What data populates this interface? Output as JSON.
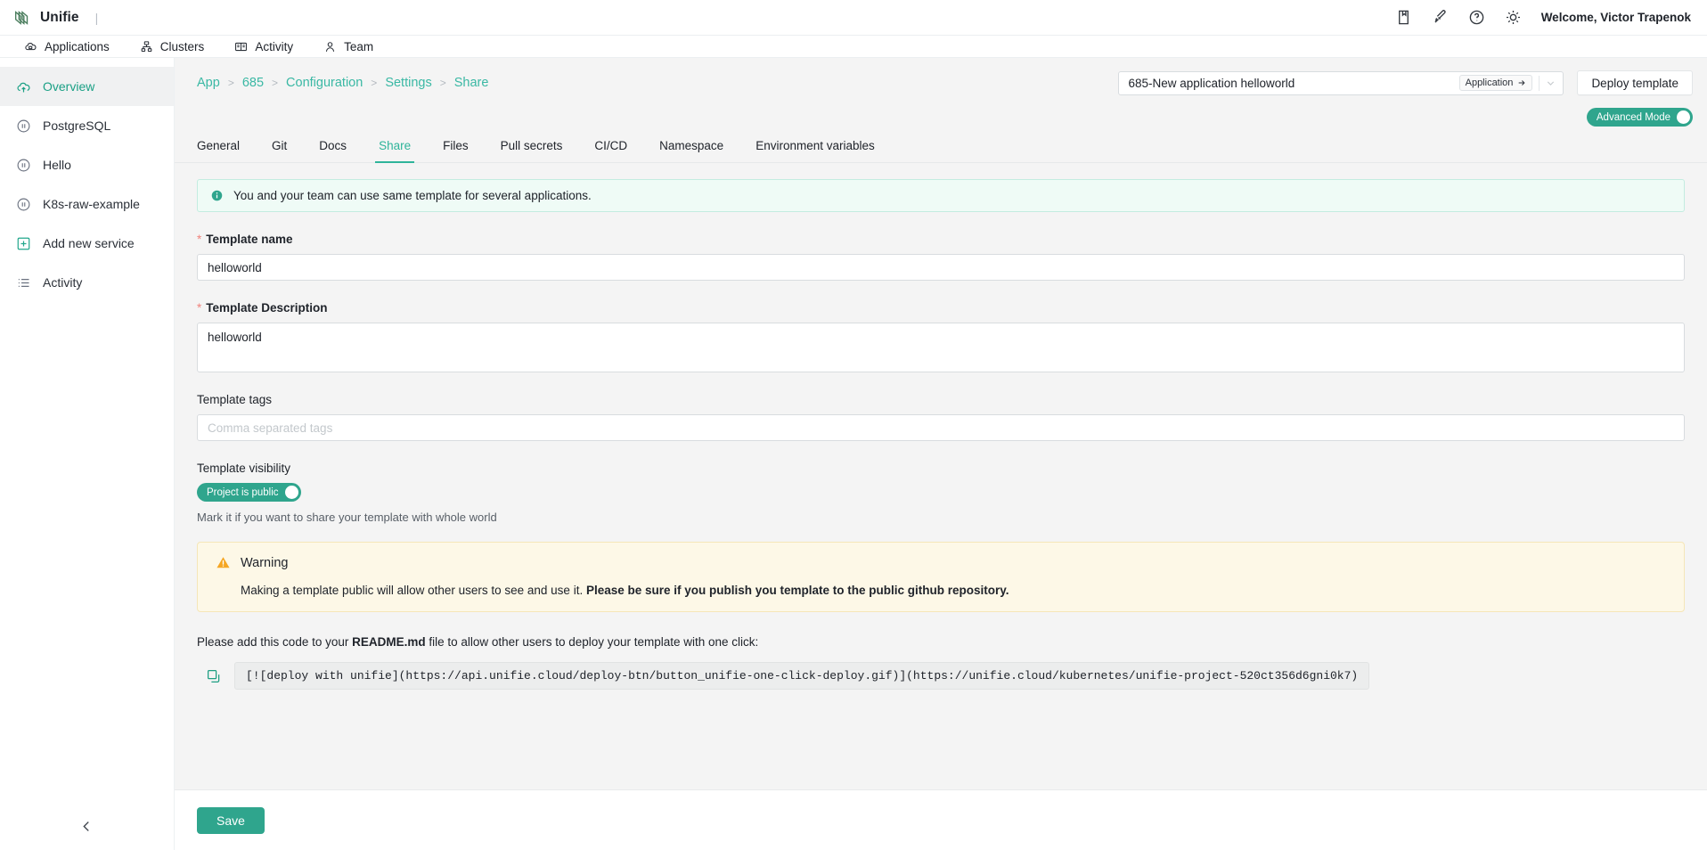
{
  "topbar": {
    "brand": "Unifie",
    "divider": "|",
    "welcome": "Welcome, Victor Trapenok",
    "icons": [
      "book-icon",
      "rocket-icon",
      "help-circle-icon",
      "sun-icon"
    ]
  },
  "nav": {
    "items": [
      {
        "label": "Applications",
        "icon": "cloud-apps-icon"
      },
      {
        "label": "Clusters",
        "icon": "cluster-icon"
      },
      {
        "label": "Activity",
        "icon": "book-open-icon"
      },
      {
        "label": "Team",
        "icon": "user-icon"
      }
    ]
  },
  "sidebar": {
    "items": [
      {
        "label": "Overview",
        "icon": "cloud-up-icon",
        "active": true
      },
      {
        "label": "PostgreSQL",
        "icon": "pause-circle-icon",
        "active": false
      },
      {
        "label": "Hello",
        "icon": "pause-circle-icon",
        "active": false
      },
      {
        "label": "K8s-raw-example",
        "icon": "pause-circle-icon",
        "active": false
      },
      {
        "label": "Add new service",
        "icon": "plus-square-icon",
        "active": false
      },
      {
        "label": "Activity",
        "icon": "list-icon",
        "active": false
      }
    ],
    "collapse_icon": "chevron-left-icon"
  },
  "breadcrumb": {
    "items": [
      "App",
      "685",
      "Configuration",
      "Settings",
      "Share"
    ],
    "separator": ">"
  },
  "header": {
    "app_select_value": "685-New application helloworld",
    "app_badge": "Application",
    "app_badge_icon": "arrow-right-icon",
    "dropdown_icon": "chevron-down-icon",
    "deploy_label": "Deploy template",
    "advanced_mode_label": "Advanced Mode",
    "advanced_mode_on": true
  },
  "tabs": [
    {
      "label": "General",
      "active": false
    },
    {
      "label": "Git",
      "active": false
    },
    {
      "label": "Docs",
      "active": false
    },
    {
      "label": "Share",
      "active": true
    },
    {
      "label": "Files",
      "active": false
    },
    {
      "label": "Pull secrets",
      "active": false
    },
    {
      "label": "CI/CD",
      "active": false
    },
    {
      "label": "Namespace",
      "active": false
    },
    {
      "label": "Environment variables",
      "active": false
    }
  ],
  "main": {
    "info_banner": "You and your team can use same template for several applications.",
    "template_name": {
      "label": "Template name",
      "required": true,
      "value": "helloworld"
    },
    "template_description": {
      "label": "Template Description",
      "required": true,
      "value": "helloworld"
    },
    "template_tags": {
      "label": "Template tags",
      "required": false,
      "value": "",
      "placeholder": "Comma separated tags"
    },
    "template_visibility": {
      "label": "Template visibility",
      "toggle_label": "Project is public",
      "toggle_on": true,
      "hint": "Mark it if you want to share your template with whole world"
    },
    "warning": {
      "title": "Warning",
      "text_normal": "Making a template public will allow other users to see and use it.",
      "text_bold": "Please be sure if you publish you template to the public github repository."
    },
    "readme": {
      "prefix": "Please add this code to your ",
      "file": "README.md",
      "suffix": " file to allow other users to deploy your template with one click:"
    },
    "code_snippet": "[![deploy with unifie](https://api.unifie.cloud/deploy-btn/button_unifie-one-click-deploy.gif)](https://unifie.cloud/kubernetes/unifie-project-520ct356d6gni0k7)",
    "copy_icon": "copy-icon"
  },
  "footer": {
    "save_label": "Save"
  },
  "colors": {
    "accent": "#2fa58d",
    "link": "#3ab8a4",
    "tab_active": "#2fb49a",
    "required": "#f0837d",
    "info_bg": "#effbf6",
    "warn_bg": "#fdf8e7",
    "warn_icon": "#f5a623",
    "page_bg": "#f4f4f4"
  }
}
